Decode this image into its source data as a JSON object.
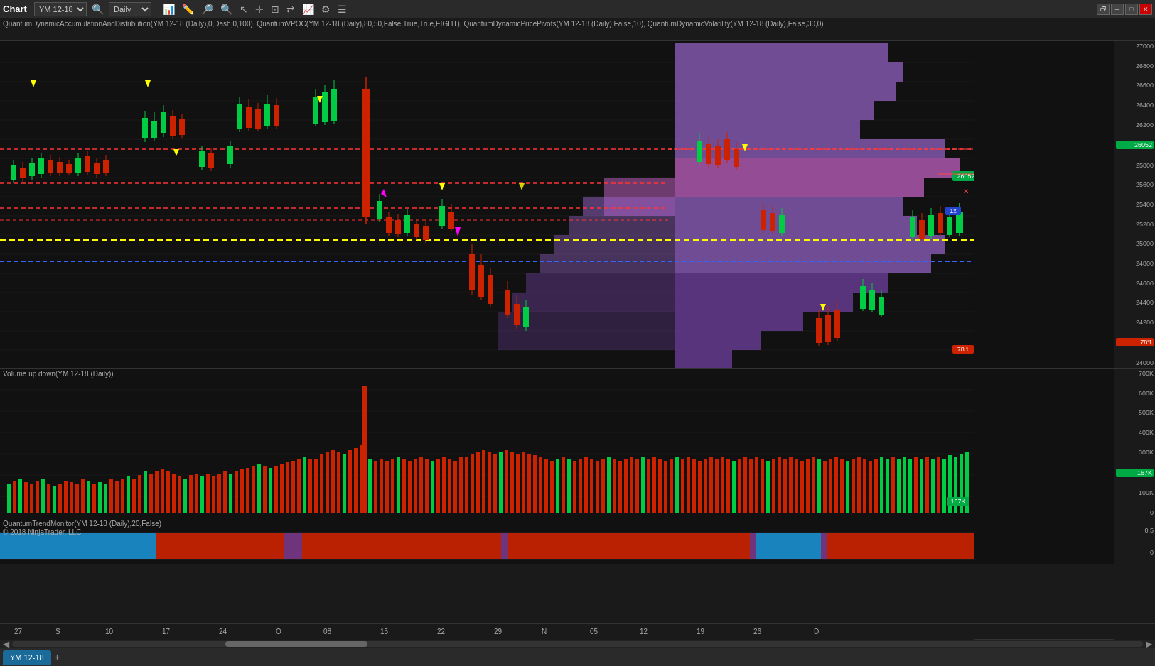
{
  "toolbar": {
    "title": "Chart",
    "symbol": "YM 12-18",
    "timeframe": "Daily",
    "icons": [
      "bars",
      "draw",
      "magnify-plus",
      "magnify-minus",
      "cursor",
      "rect-select",
      "grid",
      "crosshair",
      "properties",
      "list"
    ],
    "win_buttons": [
      "restore",
      "minimize",
      "maximize",
      "close"
    ]
  },
  "indicator_title": "QuantumDynamicAccumulationAndDistribution(YM 12-18 (Daily),0,Dash,0,100), QuantumVPOC(YM 12-18 (Daily),80,50,False,True,True,EIGHT), QuantumDynamicPricePivots(YM 12-18 (Daily),False,10), QuantumDynamicVolatility(YM 12-18 (Daily),False,30,0)",
  "price_panel": {
    "title": "",
    "current_price": "26052",
    "price_levels": [
      "27000",
      "26800",
      "26600",
      "26400",
      "26200",
      "26000",
      "25800",
      "25600",
      "25400",
      "25200",
      "25000",
      "24800",
      "24600",
      "24400",
      "24200",
      "24000"
    ],
    "price_labels_right": [
      "27000",
      "26800",
      "26600",
      "26400",
      "26200",
      "26000",
      "25800",
      "25600",
      "25400",
      "25200",
      "25000",
      "24800",
      "24600",
      "24400",
      "24200",
      "24000"
    ],
    "highlighted_price": "26052",
    "red_mark": "78'1",
    "blue_mark": "1x"
  },
  "volume_panel": {
    "title": "Volume up down(YM 12-18 (Daily))",
    "current_vol": "167K",
    "vol_levels": [
      "700K",
      "600K",
      "500K",
      "400K",
      "300K",
      "200K",
      "100K",
      "0"
    ]
  },
  "trend_panel": {
    "title": "QuantumTrendMonitor(YM 12-18 (Daily),20,False)",
    "copyright": "© 2018 NinjaTrader, LLC",
    "levels": [
      "0.5",
      "0"
    ]
  },
  "xaxis_labels": [
    "27",
    "S",
    "10",
    "17",
    "24",
    "O",
    "08",
    "15",
    "22",
    "29",
    "N",
    "05",
    "12",
    "19",
    "26",
    "D"
  ],
  "tab": {
    "label": "YM 12-18",
    "add": "+"
  }
}
